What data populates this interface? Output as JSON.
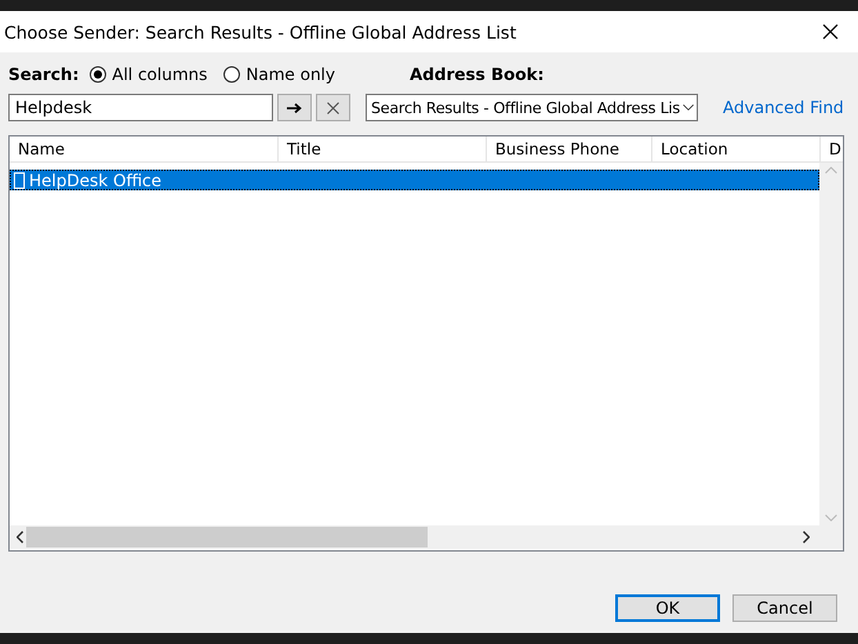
{
  "window": {
    "title": "Choose Sender: Search Results - Offline Global Address List"
  },
  "search": {
    "label": "Search:",
    "options": [
      {
        "label": "All columns",
        "selected": true
      },
      {
        "label": "Name only",
        "selected": false
      }
    ],
    "value": "Helpdesk"
  },
  "address_book": {
    "label": "Address Book:",
    "value": "Search Results - Offline Global Address Lis"
  },
  "advanced_find": "Advanced Find",
  "table": {
    "columns": [
      "Name",
      "Title",
      "Business Phone",
      "Location",
      "D"
    ],
    "rows": [
      {
        "name": "HelpDesk Office",
        "selected": true
      }
    ]
  },
  "buttons": [
    {
      "label": "OK",
      "default": true
    },
    {
      "label": "Cancel",
      "default": false
    }
  ]
}
